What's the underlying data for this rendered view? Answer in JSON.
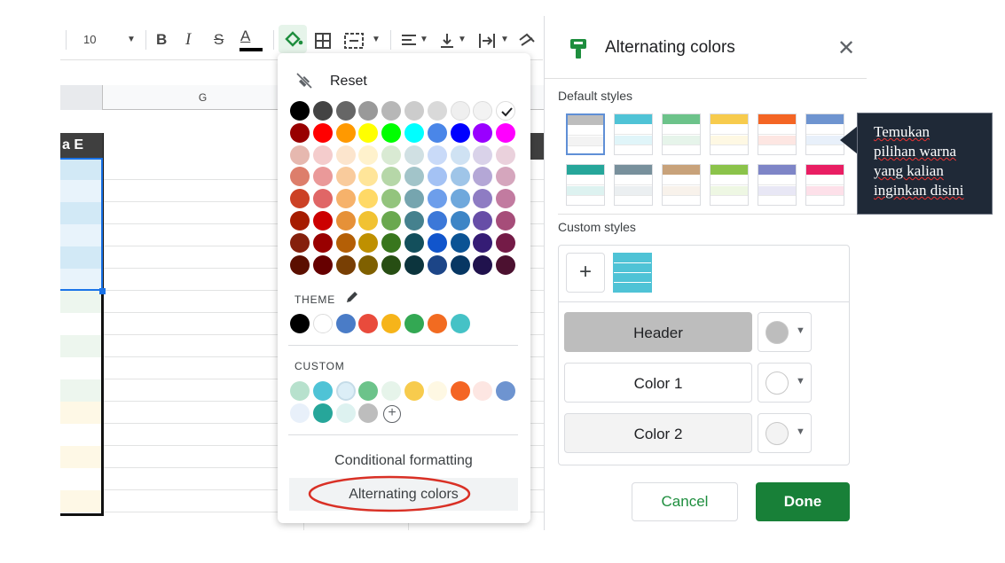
{
  "toolbar": {
    "font_size": "10",
    "bold": "B",
    "italic": "I",
    "strike": "S",
    "text_color_letter": "A"
  },
  "sheet": {
    "col_header_g": "G",
    "header_cell_text": "a E",
    "row_colors": [
      "#d2e9f6",
      "#e8f3fb",
      "#d2e9f6",
      "#e8f3fb",
      "#d2e9f6",
      "#e8f3fb",
      "#edf6ee",
      "#ffffff",
      "#edf6ee",
      "#ffffff",
      "#edf6ee",
      "#fef8e6",
      "#ffffff",
      "#fef8e6",
      "#ffffff",
      "#fef8e6"
    ]
  },
  "color_menu": {
    "reset_label": "Reset",
    "theme_label": "THEME",
    "custom_label": "CUSTOM",
    "conditional_formatting": "Conditional formatting",
    "alternating_colors": "Alternating colors",
    "palette_rows": [
      [
        "#000000",
        "#434343",
        "#666666",
        "#999999",
        "#b7b7b7",
        "#cccccc",
        "#d9d9d9",
        "#efefef",
        "#f3f3f3",
        "#ffffff"
      ],
      [
        "#980000",
        "#ff0000",
        "#ff9900",
        "#ffff00",
        "#00ff00",
        "#00ffff",
        "#4a86e8",
        "#0000ff",
        "#9900ff",
        "#ff00ff"
      ],
      [
        "#e6b8af",
        "#f4cccc",
        "#fce5cd",
        "#fff2cc",
        "#d9ead3",
        "#d0e0e3",
        "#c9daf8",
        "#cfe2f3",
        "#d9d2e9",
        "#ead1dc"
      ],
      [
        "#dd7e6b",
        "#ea9999",
        "#f9cb9c",
        "#ffe599",
        "#b6d7a8",
        "#a2c4c9",
        "#a4c2f4",
        "#9fc5e8",
        "#b4a7d6",
        "#d5a6bd"
      ],
      [
        "#cc4125",
        "#e06666",
        "#f6b26b",
        "#ffd966",
        "#93c47d",
        "#76a5af",
        "#6d9eeb",
        "#6fa8dc",
        "#8e7cc3",
        "#c27ba0"
      ],
      [
        "#a61c00",
        "#cc0000",
        "#e69138",
        "#f1c232",
        "#6aa84f",
        "#45818e",
        "#3c78d8",
        "#3d85c6",
        "#674ea7",
        "#a64d79"
      ],
      [
        "#85200c",
        "#990000",
        "#b45f06",
        "#bf9000",
        "#38761d",
        "#134f5c",
        "#1155cc",
        "#0b5394",
        "#351c75",
        "#741b47"
      ],
      [
        "#5b0f00",
        "#660000",
        "#783f04",
        "#7f6000",
        "#274e13",
        "#0c343d",
        "#1c4587",
        "#073763",
        "#20124d",
        "#4c1130"
      ]
    ],
    "theme_colors": [
      "#000000",
      "#ffffff",
      "#4a7cc7",
      "#e94b3c",
      "#f6b41a",
      "#33a853",
      "#f26b21",
      "#45c2c6"
    ],
    "custom_colors_row1": [
      "#b7e1cd",
      "#4fc3d6",
      "#dceef7",
      "#6cc38a",
      "#e6f4ea",
      "#f7cb4d",
      "#fef8e3",
      "#f46524",
      "#fde6e2",
      "#6e94d0"
    ],
    "custom_colors_row2": [
      "#e8f0fa",
      "#26a69a",
      "#ddf2f0",
      "#bdbdbd"
    ]
  },
  "panel": {
    "title": "Alternating colors",
    "default_styles_label": "Default styles",
    "custom_styles_label": "Custom styles",
    "add_label": "+",
    "header_label": "Header",
    "color1_label": "Color 1",
    "color2_label": "Color 2",
    "cancel_label": "Cancel",
    "done_label": "Done",
    "default_styles": [
      {
        "header": "#bdbdbd",
        "band": "#f3f3f3"
      },
      {
        "header": "#4fc3d6",
        "band": "#e0f5f9"
      },
      {
        "header": "#6cc38a",
        "band": "#e6f4ea"
      },
      {
        "header": "#f7cb4d",
        "band": "#fef8e3"
      },
      {
        "header": "#f46524",
        "band": "#fde6e2"
      },
      {
        "header": "#6e94d0",
        "band": "#e8f0fa"
      },
      {
        "header": "#26a69a",
        "band": "#ddf2f0"
      },
      {
        "header": "#78909c",
        "band": "#ebeff1"
      },
      {
        "header": "#c8a27a",
        "band": "#f8f2eb"
      },
      {
        "header": "#8bc34a",
        "band": "#eef7e3"
      },
      {
        "header": "#7e85c7",
        "band": "#e8e7f5"
      },
      {
        "header": "#e91e63",
        "band": "#fde0e9"
      }
    ],
    "header_color": "#bdbdbd",
    "color1": "#ffffff",
    "color2": "#f3f3f3"
  },
  "tooltip": {
    "lines": [
      "Temukan",
      "pilihan warna",
      "yang kalian",
      "inginkan disini"
    ]
  }
}
